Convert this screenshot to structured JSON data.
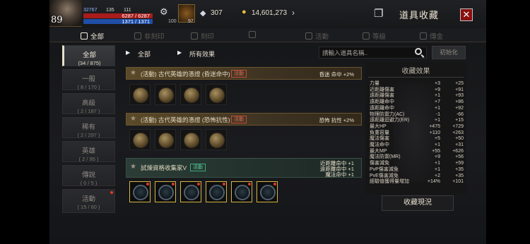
{
  "player": {
    "level": "89",
    "stat_a": "32767",
    "stat_b": "135",
    "stat_c": "111",
    "stat_d": "100",
    "hp": "6287 / 6287",
    "mp": "1371 / 1371",
    "item_count": "97"
  },
  "currency": {
    "diamonds": "307",
    "gold": "14,601,273"
  },
  "window": {
    "title": "道具收藏"
  },
  "tabs": [
    {
      "label": "全部"
    },
    {
      "label": "非刻印"
    },
    {
      "label": "刻印"
    },
    {
      "label": ""
    },
    {
      "label": "活動"
    },
    {
      "label": "等級"
    },
    {
      "label": "傳金"
    }
  ],
  "categories": [
    {
      "name": "全部",
      "count": "(34 / 875)"
    },
    {
      "name": "一般",
      "count": "( 8 / 170 )"
    },
    {
      "name": "高級",
      "count": "( 2 / 187 )"
    },
    {
      "name": "稀有",
      "count": "( 2 / 297 )"
    },
    {
      "name": "英雄",
      "count": "( 2 / 95 )"
    },
    {
      "name": "傳說",
      "count": "( 0 / 5 )"
    },
    {
      "name": "活動",
      "count": "( 15 / 60 )"
    }
  ],
  "filters": {
    "first": "全部",
    "second": "所有效果",
    "search_placeholder": "請輸入道具名稱..",
    "reset_label": "初始化"
  },
  "collections": [
    {
      "name": "(活動) 古代英雄的憑證 (昏迷命中)",
      "tag": "活動",
      "effects": [
        "昏迷 命中 +2%"
      ]
    },
    {
      "name": "(活動) 古代英雄的憑證 (恐怖抗性)",
      "tag": "活動",
      "effects": [
        "恐怖 抗性 +2%"
      ]
    },
    {
      "name": "試煉資格收集家V",
      "tag": "活動",
      "effects": [
        "近距離命中 +1",
        "遠距離命中 +1",
        "魔法命中 +1"
      ]
    }
  ],
  "stats_panel": {
    "header": "收藏效果",
    "rows": [
      {
        "k": "力量",
        "a": "+3",
        "b": "+25"
      },
      {
        "k": "近距離傷害",
        "a": "+9",
        "b": "+91"
      },
      {
        "k": "遠距離傷害",
        "a": "+1",
        "b": "+93"
      },
      {
        "k": "遠距離命中",
        "a": "+7",
        "b": "+86"
      },
      {
        "k": "遠距離命中",
        "a": "+1",
        "b": "+92"
      },
      {
        "k": "物理防禦力(AC)",
        "a": "-1",
        "b": "-66"
      },
      {
        "k": "遠距離迴避力(ER)",
        "a": "+1",
        "b": "+15"
      },
      {
        "k": "最大HP",
        "a": "+475",
        "b": "+729"
      },
      {
        "k": "負重容量",
        "a": "+110",
        "b": "+263"
      },
      {
        "k": "魔法傷害",
        "a": "+5",
        "b": "+50"
      },
      {
        "k": "魔法命中",
        "a": "+1",
        "b": "+31"
      },
      {
        "k": "最大MP",
        "a": "+55",
        "b": "+626"
      },
      {
        "k": "魔法防禦(MR)",
        "a": "+9",
        "b": "+56"
      },
      {
        "k": "傷害減免",
        "a": "+1",
        "b": "+59"
      },
      {
        "k": "PvP傷害減免",
        "a": "+1",
        "b": "+35"
      },
      {
        "k": "PvE傷害減免",
        "a": "+2",
        "b": "+35"
      },
      {
        "k": "經驗值獲得量增加",
        "a": "+14%",
        "b": "+101"
      }
    ],
    "button_label": "收藏現況"
  },
  "colors": {
    "accent_gold": "#d4b646",
    "notify_red": "#e03a2a",
    "green_text": "#7ed35a"
  }
}
